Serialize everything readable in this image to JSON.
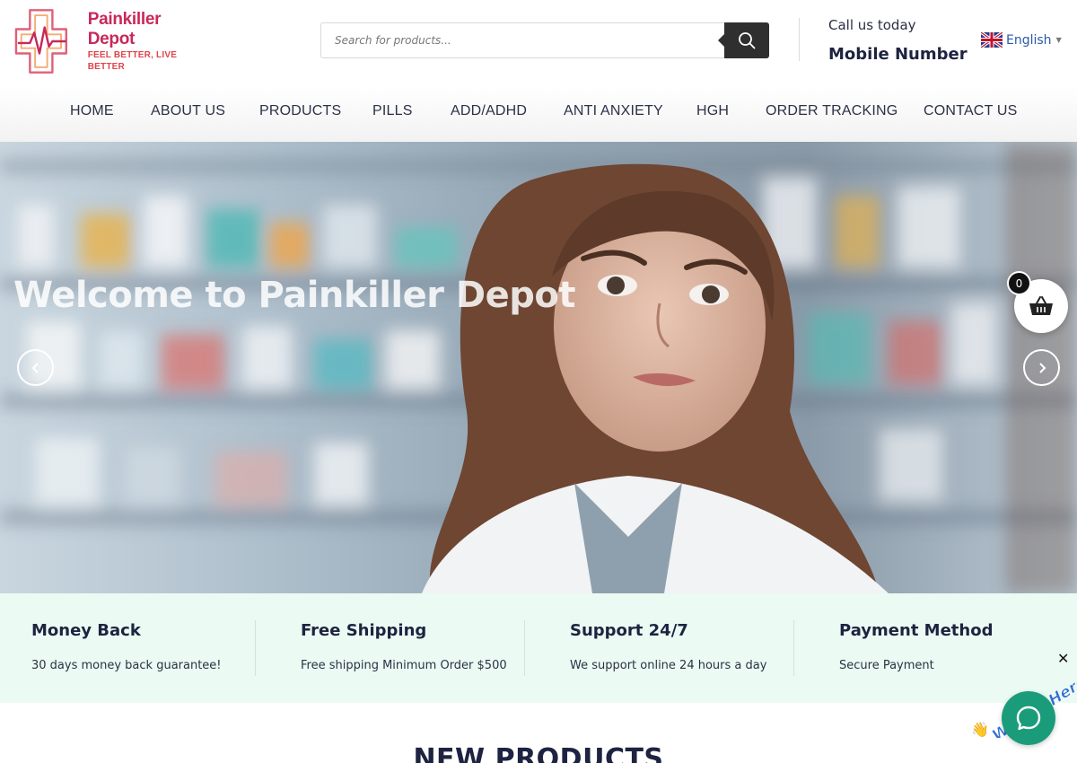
{
  "brand": {
    "name": "Painkiller Depot",
    "tagline": "FEEL BETTER, LIVE BETTER"
  },
  "search": {
    "placeholder": "Search for products..."
  },
  "contact": {
    "label": "Call us today",
    "value": "Mobile Number"
  },
  "language": {
    "selected": "English"
  },
  "nav": {
    "items": [
      {
        "label": "HOME"
      },
      {
        "label": "ABOUT US"
      },
      {
        "label": "PRODUCTS"
      },
      {
        "label": "PILLS"
      },
      {
        "label": "ADD/ADHD"
      },
      {
        "label": "ANTI ANXIETY"
      },
      {
        "label": "HGH"
      },
      {
        "label": "ORDER TRACKING"
      },
      {
        "label": "CONTACT US"
      }
    ]
  },
  "hero": {
    "title": "Welcome to Painkiller Depot"
  },
  "cart": {
    "count": "0"
  },
  "features": [
    {
      "title": "Money Back",
      "desc": "30 days money back guarantee!"
    },
    {
      "title": "Free Shipping",
      "desc": "Free shipping Minimum Order $500"
    },
    {
      "title": "Support 24/7",
      "desc": "We support online 24 hours a day"
    },
    {
      "title": "Payment Method",
      "desc": "Secure Payment"
    }
  ],
  "section": {
    "new_products": "NEW PRODUCTS"
  },
  "chat": {
    "label": "We Are Here!",
    "close": "✕"
  },
  "colors": {
    "brand_pink": "#c8285a",
    "brand_orange": "#f08a3c",
    "accent_green": "#1a9c7a",
    "feature_bg": "#ebfaf2",
    "chat_text": "#2f6fd6"
  }
}
